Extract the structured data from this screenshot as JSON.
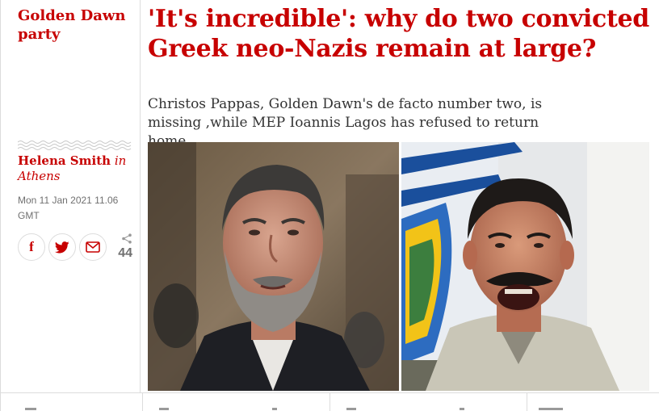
{
  "series": {
    "label": "Golden Dawn party"
  },
  "byline": {
    "author": "Helena Smith",
    "location": "in Athens"
  },
  "dateline": {
    "text": "Mon 11 Jan 2021 11.06 GMT"
  },
  "share": {
    "count": "44",
    "facebook_icon": "f",
    "accent": "#c70000"
  },
  "article": {
    "headline": "'It's incredible': why do two convicted Greek neo-Nazis remain at large?",
    "standfirst": "Christos Pappas, Golden Dawn's de facto number two, is missing ,while MEP Ioannis Lagos has refused to return home"
  },
  "colors": {
    "news_red": "#c70000",
    "text": "#333333",
    "muted": "#707070",
    "border": "#dcdcdc"
  }
}
